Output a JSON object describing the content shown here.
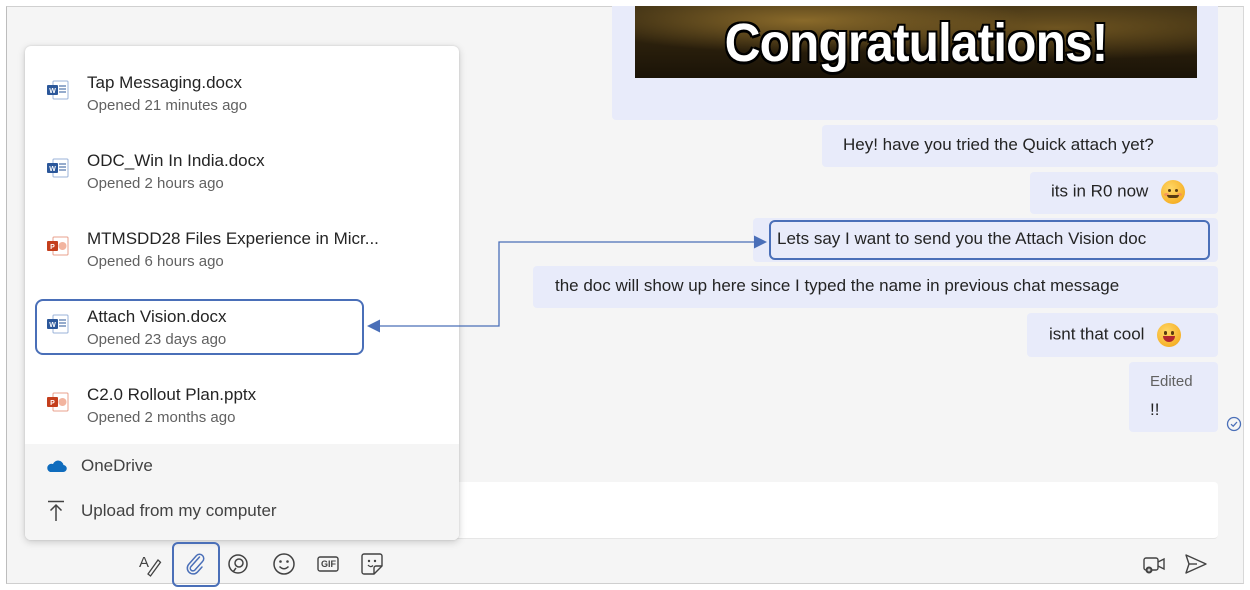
{
  "chat": {
    "gif_text": "Congratulations!",
    "messages": [
      {
        "text": "Hey! have you tried the Quick attach yet?"
      },
      {
        "text": "its in R0 now",
        "emoji": "smiling-face-icon"
      },
      {
        "text": "Lets say I want to send you the Attach Vision doc"
      },
      {
        "text": "the doc will show up here since I typed the name in previous chat message"
      },
      {
        "text": "isnt that cool",
        "emoji": "grinning-face-icon"
      },
      {
        "edited_label": "Edited",
        "text": "!!"
      }
    ]
  },
  "attach_menu": {
    "recent_files": [
      {
        "name": "Tap Messaging.docx",
        "meta": "Opened 21 minutes ago",
        "icon": "word-doc-icon"
      },
      {
        "name": "ODC_Win In India.docx",
        "meta": "Opened 2 hours ago",
        "icon": "word-doc-icon"
      },
      {
        "name": "MTMSDD28 Files Experience in Micr...",
        "meta": "Opened 6 hours ago",
        "icon": "powerpoint-icon"
      },
      {
        "name": "Attach Vision.docx",
        "meta": "Opened 23 days ago",
        "icon": "word-doc-icon"
      },
      {
        "name": "C2.0 Rollout Plan.pptx",
        "meta": "Opened 2 months ago",
        "icon": "powerpoint-icon"
      }
    ],
    "onedrive_label": "OneDrive",
    "upload_label": "Upload from my computer"
  },
  "toolbar": {
    "icons": [
      "format-icon",
      "attach-icon",
      "loop-icon",
      "emoji-icon",
      "gif-icon",
      "sticker-icon"
    ],
    "gif_label": "GIF",
    "right_icons": [
      "meet-now-icon",
      "send-icon"
    ]
  },
  "colors": {
    "bubble": "#e8ebfa",
    "highlight": "#4a6fb8",
    "word_blue": "#2b579a",
    "ppt_red": "#c43e1c",
    "onedrive_blue": "#0f6cbd"
  }
}
